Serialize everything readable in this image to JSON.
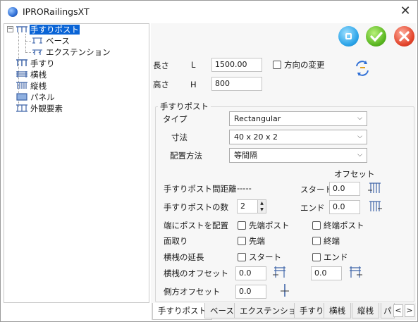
{
  "window": {
    "title": "IPRORailingsXT",
    "close_glyph": "✕"
  },
  "tree": {
    "items": [
      {
        "label": "手すりポスト",
        "icon": "post-icon",
        "selected": true
      },
      {
        "label": "ベース",
        "icon": "base-icon"
      },
      {
        "label": "エクステンション",
        "icon": "extension-icon"
      },
      {
        "label": "手すり",
        "icon": "handrail-icon"
      },
      {
        "label": "横桟",
        "icon": "horizontal-rail-icon"
      },
      {
        "label": "縦桟",
        "icon": "vertical-rail-icon"
      },
      {
        "label": "パネル",
        "icon": "panel-icon"
      },
      {
        "label": "外観要素",
        "icon": "appearance-icon"
      }
    ]
  },
  "actions": {
    "blue_icon": "minimize-dot-icon",
    "ok_icon": "check-icon",
    "cancel_icon": "x-icon"
  },
  "dims": {
    "length_label": "長さ",
    "length_symbol": "L",
    "length_value": "1500.00",
    "height_label": "高さ",
    "height_symbol": "H",
    "height_value": "800",
    "direction_label": "方向の変更"
  },
  "post_group": {
    "title": "手すりポスト",
    "type_label": "タイプ",
    "type_value": "Rectangular",
    "size_label": "寸法",
    "size_value": "40 x 20 x 2",
    "placement_label": "配置方法",
    "placement_value": "等間隔",
    "offset_header": "オフセット",
    "spacing_label": "手すりポスト間距離",
    "spacing_value": "-----",
    "start_label": "スタート",
    "start_value": "0.0",
    "count_label": "手すりポストの数",
    "count_value": "2",
    "end_label": "エンド",
    "end_value": "0.0",
    "end_posts_label": "端にポストを配置",
    "first_post_label": "先端ポスト",
    "last_post_label": "終端ポスト",
    "chamfer_label": "面取り",
    "chamfer_first_label": "先端",
    "chamfer_last_label": "終端",
    "extend_label": "横桟の延長",
    "extend_start_label": "スタート",
    "extend_end_label": "エンド",
    "rail_offset_label": "横桟のオフセット",
    "rail_offset_value1": "0.0",
    "rail_offset_value2": "0.0",
    "side_offset_label": "側方オフセット",
    "side_offset_value": "0.0"
  },
  "tabs": [
    "手すりポスト",
    "ベース",
    "エクステンション",
    "手すり",
    "横桟",
    "縦桟",
    "パ"
  ],
  "tab_nav": {
    "prev": "<",
    "next": ">"
  }
}
